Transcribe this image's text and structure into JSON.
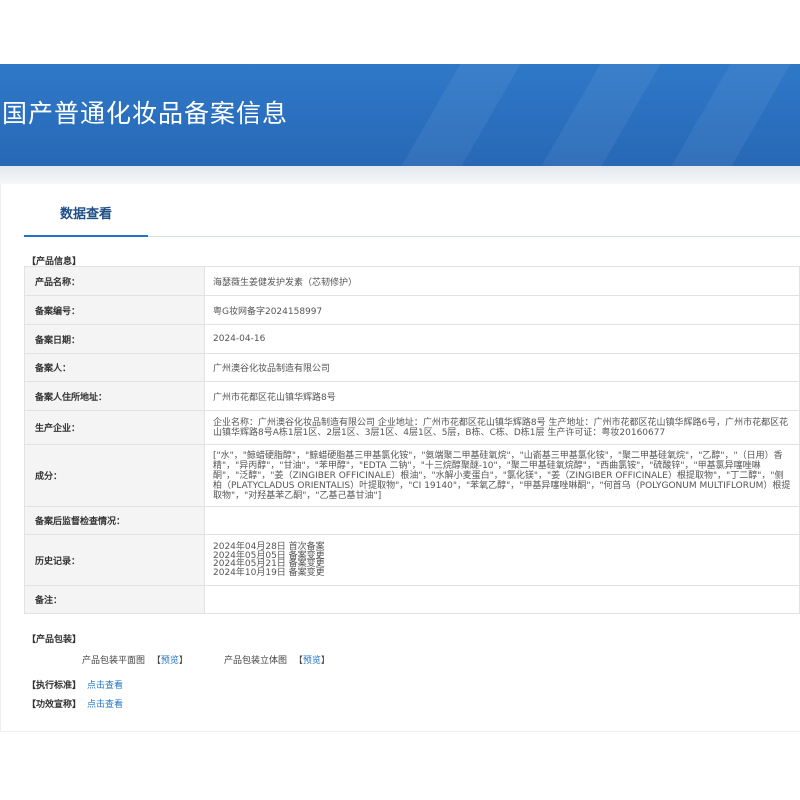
{
  "header": {
    "title": "国产普通化妆品备案信息"
  },
  "tab": {
    "label": "数据查看"
  },
  "product_info": {
    "section_title": "【产品信息】",
    "rows": [
      {
        "label": "产品名称：",
        "value": "海瑟薇生姜健发护发素（芯韧修护）"
      },
      {
        "label": "备案编号：",
        "value": "粤G妆网备字2024158997"
      },
      {
        "label": "备案日期：",
        "value": "2024-04-16"
      },
      {
        "label": "备案人：",
        "value": "广州澳谷化妆品制造有限公司"
      },
      {
        "label": "备案人住所地址：",
        "value": "广州市花都区花山镇华辉路8号"
      },
      {
        "label": "生产企业：",
        "value": "企业名称：广州澳谷化妆品制造有限公司 企业地址：广州市花都区花山镇华辉路8号 生产地址：广州市花都区花山镇华辉路6号，广州市花都区花山镇华辉路8号A栋1层1区、2层1区、3层1区、4层1区、5层，B栋、C栋、D栋1层 生产许可证：粤妆20160677"
      },
      {
        "label": "成分：",
        "value": "[\"水\"，\"鲸蜡硬脂醇\"，\"鲸蜡硬脂基三甲基氯化铵\"，\"氨端聚二甲基硅氧烷\"，\"山嵛基三甲基氯化铵\"，\"聚二甲基硅氧烷\"，\"乙醇\"，\"（日用）香精\"，\"异丙醇\"，\"甘油\"，\"苯甲醇\"，\"EDTA 二钠\"，\"十三烷醇聚醚-10\"，\"聚二甲基硅氧烷醇\"，\"西曲氯铵\"，\"硫酸锌\"，\"甲基氯异噻唑啉酮\"，\"泛醇\"，\"姜（ZINGIBER OFFICINALE）根油\"，\"水解小麦蛋白\"，\"氯化镁\"，\"姜（ZINGIBER OFFICINALE）根提取物\"，\"丁二醇\"，\"侧柏（PLATYCLADUS ORIENTALIS）叶提取物\"，\"CI 19140\"，\"苯氧乙醇\"，\"甲基异噻唑啉酮\"，\"何首乌（POLYGONUM MULTIFLORUM）根提取物\"，\"对羟基苯乙酮\"，\"乙基己基甘油\"]"
      },
      {
        "label": "备案后监督检查情况：",
        "value": ""
      },
      {
        "label": "历史记录：",
        "history": [
          "2024年04月28日 首次备案",
          "2024年05月05日 备案变更",
          "2024年05月21日 备案变更",
          "2024年10月19日 备案变更"
        ]
      },
      {
        "label": "备注：",
        "value": ""
      }
    ]
  },
  "packaging": {
    "section_title": "【产品包装】",
    "flat_label": "产品包装平面图",
    "stereo_label": "产品包装立体图",
    "preview_open": "【",
    "preview_link": "预览",
    "preview_close": "】"
  },
  "standard": {
    "label": "【执行标准】",
    "link": "点击查看"
  },
  "efficacy": {
    "label": "【功效宣称】",
    "link": "点击查看"
  },
  "colors": {
    "banner": "#2a6fbe",
    "accent": "#1f74c4",
    "label_bg": "#f4f4f4"
  }
}
